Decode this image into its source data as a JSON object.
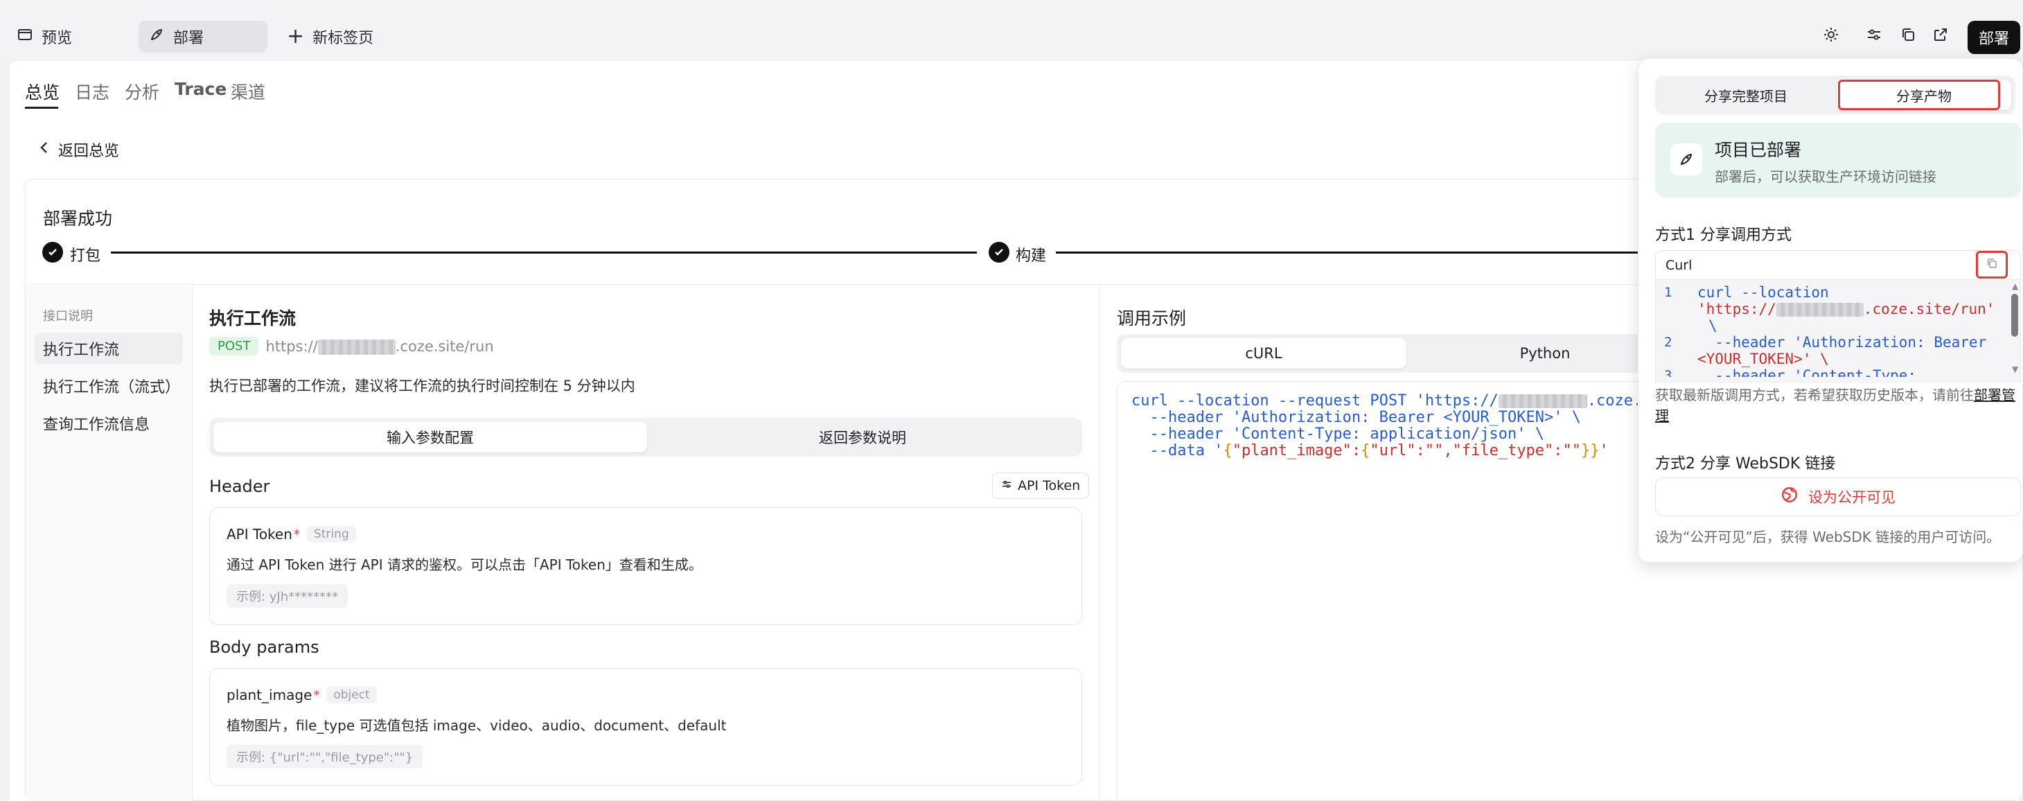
{
  "tabs": {
    "preview": "预览",
    "deploy": "部署",
    "new_tab": "新标签页"
  },
  "header": {
    "deploy_button": "部署"
  },
  "subtabs": [
    "总览",
    "日志",
    "分析",
    "Trace",
    "渠道"
  ],
  "back_link": "返回总览",
  "deploy_status": {
    "title": "部署成功",
    "steps": [
      "打包",
      "构建"
    ]
  },
  "left_nav": {
    "section": "接口说明",
    "items": [
      "执行工作流",
      "执行工作流（流式）",
      "查询工作流信息"
    ]
  },
  "endpoint": {
    "title": "执行工作流",
    "method": "POST",
    "url_prefix": "https://",
    "url_suffix": ".coze.site/run",
    "description": "执行已部署的工作流，建议将工作流的执行时间控制在 5 分钟以内",
    "seg_input": "输入参数配置",
    "seg_output": "返回参数说明",
    "header_title": "Header",
    "api_token_button": "API Token",
    "param_api_token": {
      "name": "API Token",
      "type": "String",
      "desc": "通过 API Token 进行 API 请求的鉴权。可以点击「API Token」查看和生成。",
      "example": "示例: yJh********"
    },
    "body_title": "Body params",
    "param_plant_image": {
      "name": "plant_image",
      "type": "object",
      "desc": "植物图片，file_type 可选值包括 image、video、audio、document、default",
      "example": "示例: {\"url\":\"\",\"file_type\":\"\"}"
    }
  },
  "example": {
    "title": "调用示例",
    "tab_curl": "cURL",
    "tab_python": "Python",
    "code_line1_a": "curl --location --request POST 'https://",
    "code_line1_b": ".coze.si",
    "code_line2": "  --header 'Authorization: Bearer <YOUR_TOKEN>' \\",
    "code_line3": "  --header 'Content-Type: application/json' \\",
    "code_line4_a": "  --data '",
    "code_line4_b": "{",
    "code_line4_c": "\"plant_image\":",
    "code_line4_d": "{",
    "code_line4_e": "\"url\":\"\",\"file_type\":\"\"",
    "code_line4_f": "}}",
    "code_line4_g": "'"
  },
  "popover": {
    "tab_full": "分享完整项目",
    "tab_artifact": "分享产物",
    "banner_title": "项目已部署",
    "banner_desc": "部署后，可以获取生产环境访问链接",
    "method1_title": "方式1 分享调用方式",
    "select_value": "Curl",
    "code_lines": [
      {
        "num": "1",
        "a": "curl --location",
        "b": "'https://",
        "c": ".coze.site/run'",
        "d": "\\"
      },
      {
        "num": "2",
        "a": "  --header 'Authorization: Bearer",
        "b": "<YOUR_TOKEN>' \\"
      },
      {
        "num": "3",
        "a": "  --header 'Content-Type:"
      }
    ],
    "note_a": "获取最新版调用方式，若希望获取历史版本，请前往",
    "note_link": "部署管理",
    "method2_title": "方式2 分享 WebSDK 链接",
    "public_button": "设为公开可见",
    "method2_note": "设为“公开可见”后，获得 WebSDK 链接的用户可访问。"
  },
  "colors": {
    "accent_red": "#e0393e",
    "post_badge_bg": "#e3f5e6",
    "post_badge_text": "#2e9a48",
    "banner_bg": "#e6f5ef"
  }
}
